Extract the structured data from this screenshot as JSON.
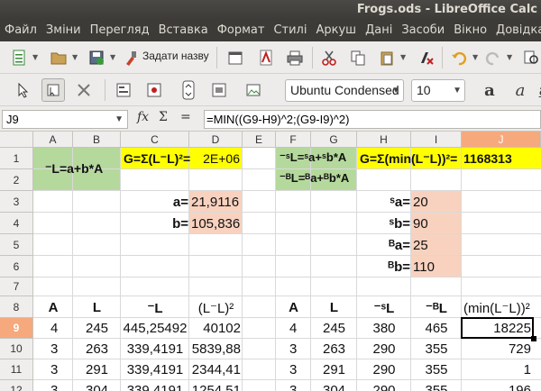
{
  "window": {
    "title": "Frogs.ods - LibreOffice Calc"
  },
  "menu": [
    "Файл",
    "Зміни",
    "Перегляд",
    "Вставка",
    "Формат",
    "Стилі",
    "Аркуш",
    "Дані",
    "Засоби",
    "Вікно",
    "Довідка"
  ],
  "toolbar": {
    "style_name": "Задати назву",
    "font_name": "Ubuntu Condensed",
    "font_size": "10"
  },
  "formula_bar": {
    "cell_ref": "J9",
    "formula": "=MIN((G9-H9)^2;(G9-I9)^2)",
    "fx": "fx",
    "sum": "Σ",
    "eq": "="
  },
  "columns": [
    "A",
    "B",
    "C",
    "D",
    "E",
    "F",
    "G",
    "H",
    "I",
    "J"
  ],
  "rows": [
    "1",
    "2",
    "3",
    "4",
    "5",
    "6",
    "7",
    "8",
    "9",
    "10",
    "11",
    "12"
  ],
  "cells": {
    "label_formula": "⁻L=a+b*A",
    "G_text": "G=Σ(L⁻L)²=",
    "G_value": "2E+06",
    "sL": "⁻ˢL=ˢa+ˢb*A",
    "bL": "⁻ᴮL=ᴮa+ᴮb*A",
    "Gmin_text": "G=Σ(min(L⁻L))²=",
    "Gmin_value": "1168313",
    "a_label": "a=",
    "a_value": "21,9116",
    "b_label": "b=",
    "b_value": "105,836",
    "sa_label": "ˢa=",
    "sa_value": "20",
    "sb_label": "ˢb=",
    "sb_value": "90",
    "Ba_label": "ᴮa=",
    "Ba_value": "25",
    "Bb_label": "ᴮb=",
    "Bb_value": "110",
    "h_A": "A",
    "h_L": "L",
    "h_Lcalc": "⁻L",
    "h_Ldiff": "(L⁻L)²",
    "h_A2": "A",
    "h_L2": "L",
    "h_sL": "⁻ˢL",
    "h_BL": "⁻ᴮL",
    "h_min": "(min(L⁻L))²"
  },
  "data_rows": [
    [
      "4",
      "245",
      "445,25492",
      "40102",
      "4",
      "245",
      "380",
      "465",
      "18225"
    ],
    [
      "3",
      "263",
      "339,4191",
      "5839,88",
      "3",
      "263",
      "290",
      "355",
      "729"
    ],
    [
      "3",
      "291",
      "339,4191",
      "2344,41",
      "3",
      "291",
      "290",
      "355",
      "1"
    ],
    [
      "3",
      "304",
      "339,4191",
      "1254,51",
      "3",
      "304",
      "290",
      "355",
      "196"
    ]
  ],
  "colors": {
    "green": "#b5d99c",
    "yellow": "#ffff00",
    "salmon": "#f8d2bf",
    "selection": "#f6a97c"
  }
}
